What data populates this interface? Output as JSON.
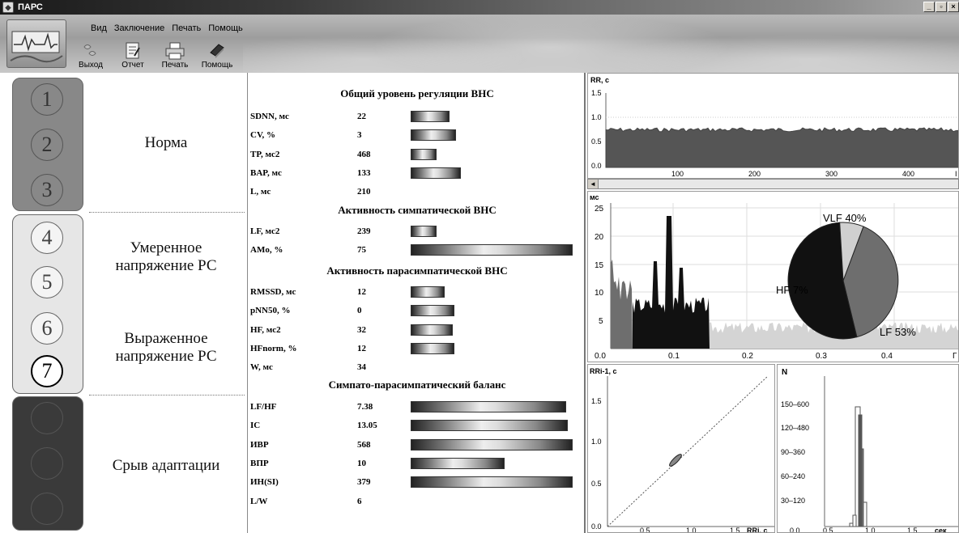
{
  "window": {
    "title": "ПАРС",
    "min": "_",
    "max": "▫",
    "close": "×"
  },
  "menu": [
    "Вид",
    "Заключение",
    "Печать",
    "Помощь"
  ],
  "toolbar": [
    {
      "label": "Выход",
      "icon": "exit-icon"
    },
    {
      "label": "Отчет",
      "icon": "report-icon"
    },
    {
      "label": "Печать",
      "icon": "printer-icon"
    },
    {
      "label": "Помощь",
      "icon": "help-book-icon"
    }
  ],
  "zones": {
    "circles": [
      "1",
      "2",
      "3",
      "4",
      "5",
      "6",
      "7"
    ],
    "active_circle": "7",
    "labels": {
      "norm": "Норма",
      "moderate": "Умеренное напряжение РС",
      "severe": "Выраженное напряжение РС",
      "failure": "Срыв адаптации"
    }
  },
  "indicators": {
    "sections": [
      {
        "title": "Общий уровень регуляции ВНС",
        "rows": [
          {
            "label": "SDNN, мс",
            "value": "22",
            "bar": 0.24
          },
          {
            "label": "CV, %",
            "value": "3",
            "bar": 0.28
          },
          {
            "label": "TP, мс2",
            "value": "468",
            "bar": 0.16
          },
          {
            "label": "BAP, мс",
            "value": "133",
            "bar": 0.31
          },
          {
            "label": "L, мс",
            "value": "210",
            "bar": 0
          }
        ]
      },
      {
        "title": "Активность симпатической ВНС",
        "rows": [
          {
            "label": "LF, мс2",
            "value": "239",
            "bar": 0.16
          },
          {
            "label": "AMo, %",
            "value": "75",
            "bar": 1.0
          }
        ]
      },
      {
        "title": "Активность парасимпатической ВНС",
        "rows": [
          {
            "label": "RMSSD, мс",
            "value": "12",
            "bar": 0.21
          },
          {
            "label": "pNN50, %",
            "value": "0",
            "bar": 0.27
          },
          {
            "label": "HF, мс2",
            "value": "32",
            "bar": 0.26
          },
          {
            "label": "HFnorm, %",
            "value": "12",
            "bar": 0.27
          },
          {
            "label": "W, мс",
            "value": "34",
            "bar": 0
          }
        ]
      },
      {
        "title": "Симпато-парасимпатический баланс",
        "rows": [
          {
            "label": "LF/HF",
            "value": "7.38",
            "bar": 0.96
          },
          {
            "label": "IC",
            "value": "13.05",
            "bar": 0.97
          },
          {
            "label": "ИВР",
            "value": "568",
            "bar": 1.0
          },
          {
            "label": "ВПР",
            "value": "10",
            "bar": 0.58
          },
          {
            "label": "ИН(SI)",
            "value": "379",
            "bar": 1.0
          },
          {
            "label": "L/W",
            "value": "6",
            "bar": 0
          }
        ]
      }
    ]
  },
  "charts": {
    "rr": {
      "ylabel": "RR, с",
      "yticks": [
        "1.5",
        "1.0",
        "0.5",
        "0.0"
      ],
      "xticks": [
        "100",
        "200",
        "300",
        "400"
      ],
      "x_extra": "I"
    },
    "spectrum": {
      "ylabel": "мс",
      "yticks": [
        "25",
        "20",
        "15",
        "10",
        "5"
      ],
      "xticks": [
        "0.0",
        "0.1",
        "0.2",
        "0.3",
        "0.4"
      ],
      "xunit": "Г",
      "pie": [
        {
          "name": "VLF 40%",
          "share": 40,
          "color": "#6e6e6e"
        },
        {
          "name": "LF 53%",
          "share": 53,
          "color": "#111111"
        },
        {
          "name": "HF  7%",
          "share": 7,
          "color": "#d0d0d0"
        }
      ]
    },
    "scatter": {
      "ylabel": "RRi-1, с",
      "xlabel": "RRi, с",
      "yticks": [
        "1.5",
        "1.0",
        "0.5",
        "0.0"
      ],
      "xticks": [
        "0.5",
        "1.0",
        "1.5"
      ]
    },
    "histogram": {
      "ylabel": "N",
      "xlabel": "сек",
      "yticks": [
        "150–600",
        "120–480",
        "90–360",
        "60–240",
        "30–120"
      ],
      "xticks": [
        "0.0",
        "0.5",
        "1.0",
        "1.5"
      ]
    }
  },
  "colors": {
    "zone_norm": "#888888",
    "zone_moderate": "#e6e6e6",
    "zone_failure": "#3a3a3a",
    "rr_fill": "#555555"
  }
}
